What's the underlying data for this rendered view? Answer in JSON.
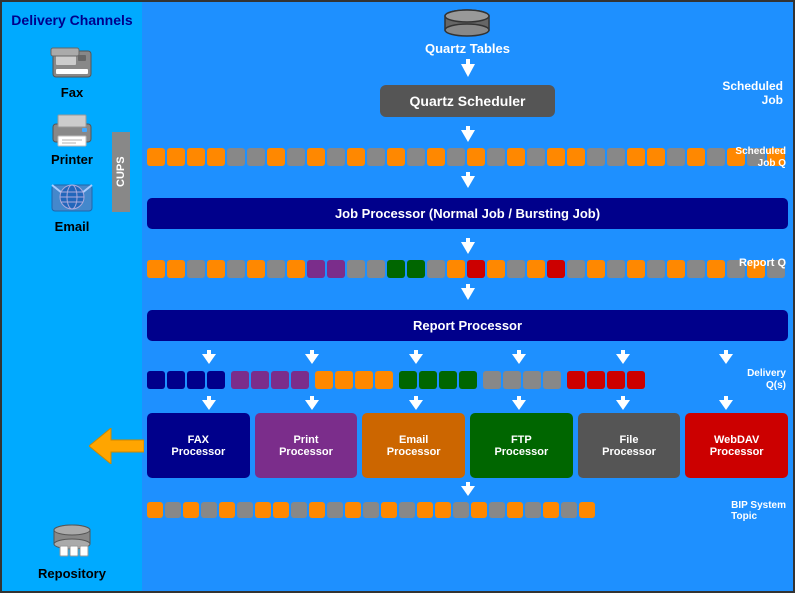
{
  "header": {
    "quartz_tables": "Quartz Tables",
    "quartz_scheduler": "Quartz Scheduler",
    "scheduled_job": "Scheduled\nJob",
    "scheduled_job_q": "Scheduled\nJob Q",
    "report_q": "Report Q",
    "delivery_q": "Delivery\nQ(s)",
    "bip_system_topic": "BIP System\nTopic"
  },
  "sidebar": {
    "delivery_channels": "Delivery\nChannels",
    "cups": "CUPS",
    "items": [
      {
        "label": "Fax"
      },
      {
        "label": "Printer"
      },
      {
        "label": "Email"
      },
      {
        "label": "Repository"
      }
    ]
  },
  "processors": {
    "job_processor": "Job Processor (Normal Job / Bursting Job)",
    "report_processor": "Report Processor",
    "fax": "FAX\nProcessor",
    "print": "Print\nProcessor",
    "email": "Email\nProcessor",
    "ftp": "FTP\nProcessor",
    "file": "File\nProcessor",
    "webdav": "WebDAV\nProcessor"
  },
  "colors": {
    "main_bg": "#1e90ff",
    "sidebar_bg": "#00aaff",
    "processor_dark": "#00008B",
    "processor_purple": "#7B2D8B",
    "processor_orange": "#cc6600",
    "processor_green": "#006600",
    "processor_gray": "#555555",
    "processor_red": "#cc0000"
  }
}
